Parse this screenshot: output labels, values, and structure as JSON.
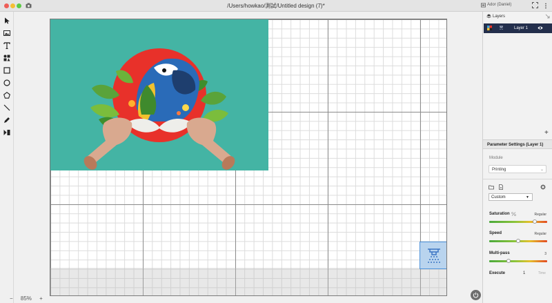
{
  "window": {
    "title": "/Users/howkao/測試/Untitled design (7)*",
    "device_name": "Ador (Daniel)"
  },
  "toolbar": {
    "tools": [
      "pointer-tool",
      "image-tool",
      "text-tool",
      "element-tool",
      "rectangle-tool",
      "ellipse-tool",
      "polygon-tool",
      "line-tool",
      "pen-tool",
      "dmkt-tool"
    ]
  },
  "canvas": {
    "zoom_minus": "−",
    "zoom_value": "85%",
    "zoom_plus": "+",
    "image_bg_color": "#44b4a4",
    "accent_red": "#e8312a"
  },
  "layers_panel": {
    "title": "Layers",
    "layer_name": "Layer 1",
    "add_label": "+"
  },
  "parameters": {
    "title": "Parameter Settings (Layer 1)",
    "module_label": "Module",
    "module_value": "Printing",
    "preset_value": "Custom",
    "saturation_label": "Saturation",
    "saturation_value": "Regular",
    "saturation_level": 0.78,
    "speed_label": "Speed",
    "speed_value": "Regular",
    "speed_level": 0.5,
    "multipass_label": "Multi-pass",
    "multipass_value": "3",
    "multipass_level": 0.33,
    "execute_label": "Execute",
    "execute_value": "1",
    "execute_unit": "Time"
  }
}
